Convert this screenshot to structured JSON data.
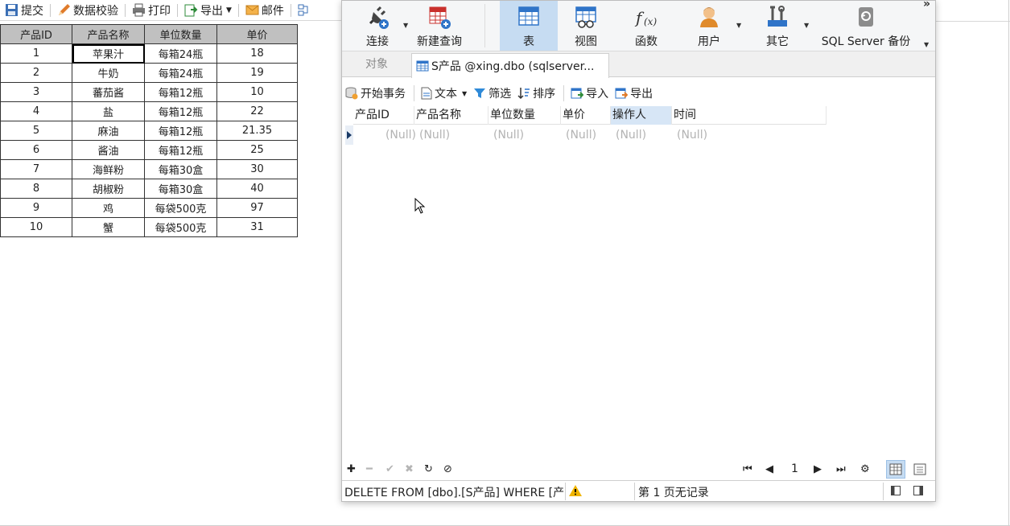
{
  "background_app": {
    "toolbar": [
      {
        "label": "提交",
        "icon": "save-icon"
      },
      {
        "label": "数据校验",
        "icon": "pencil-icon"
      },
      {
        "label": "打印",
        "icon": "printer-icon"
      },
      {
        "label": "导出",
        "icon": "export-icon"
      },
      {
        "label": "邮件",
        "icon": "mail-icon"
      }
    ],
    "table": {
      "headers": [
        "产品ID",
        "产品名称",
        "单位数量",
        "单价"
      ],
      "rows": [
        [
          "1",
          "苹果汁",
          "每箱24瓶",
          "18"
        ],
        [
          "2",
          "牛奶",
          "每箱24瓶",
          "19"
        ],
        [
          "3",
          "蕃茄酱",
          "每箱12瓶",
          "10"
        ],
        [
          "4",
          "盐",
          "每箱12瓶",
          "22"
        ],
        [
          "5",
          "麻油",
          "每箱12瓶",
          "21.35"
        ],
        [
          "6",
          "酱油",
          "每箱12瓶",
          "25"
        ],
        [
          "7",
          "海鲜粉",
          "每箱30盒",
          "30"
        ],
        [
          "8",
          "胡椒粉",
          "每箱30盒",
          "40"
        ],
        [
          "9",
          "鸡",
          "每袋500克",
          "97"
        ],
        [
          "10",
          "蟹",
          "每袋500克",
          "31"
        ]
      ]
    }
  },
  "navicat": {
    "ribbon": [
      {
        "label": "连接",
        "icon": "plug-icon"
      },
      {
        "label": "新建查询",
        "icon": "new-query-icon"
      },
      {
        "label": "表",
        "icon": "table-icon"
      },
      {
        "label": "视图",
        "icon": "view-icon"
      },
      {
        "label": "函数",
        "icon": "function-icon"
      },
      {
        "label": "用户",
        "icon": "user-icon"
      },
      {
        "label": "其它",
        "icon": "tools-icon"
      },
      {
        "label": "SQL Server 备份",
        "icon": "backup-icon"
      }
    ],
    "more": "»",
    "tabs": {
      "objects": "对象",
      "active": "S产品 @xing.dbo (sqlserver..."
    },
    "toolbar": {
      "begin_transaction": "开始事务",
      "text": "文本",
      "filter": "筛选",
      "sort": "排序",
      "import": "导入",
      "export": "导出"
    },
    "grid": {
      "columns": [
        "产品ID",
        "产品名称",
        "单位数量",
        "单价",
        "操作人",
        "时间"
      ],
      "row": [
        "(Null)",
        "(Null)",
        "(Null)",
        "(Null)",
        "(Null)",
        "(Null)"
      ]
    },
    "pager": {
      "page": "1"
    },
    "status": {
      "sql": "DELETE FROM [dbo].[S产品] WHERE [产",
      "records": "第 1 页无记录"
    },
    "colors": {
      "accent": "#c6dcf2",
      "header_bg": "#c0c0c0",
      "warning": "#f0b400"
    }
  }
}
